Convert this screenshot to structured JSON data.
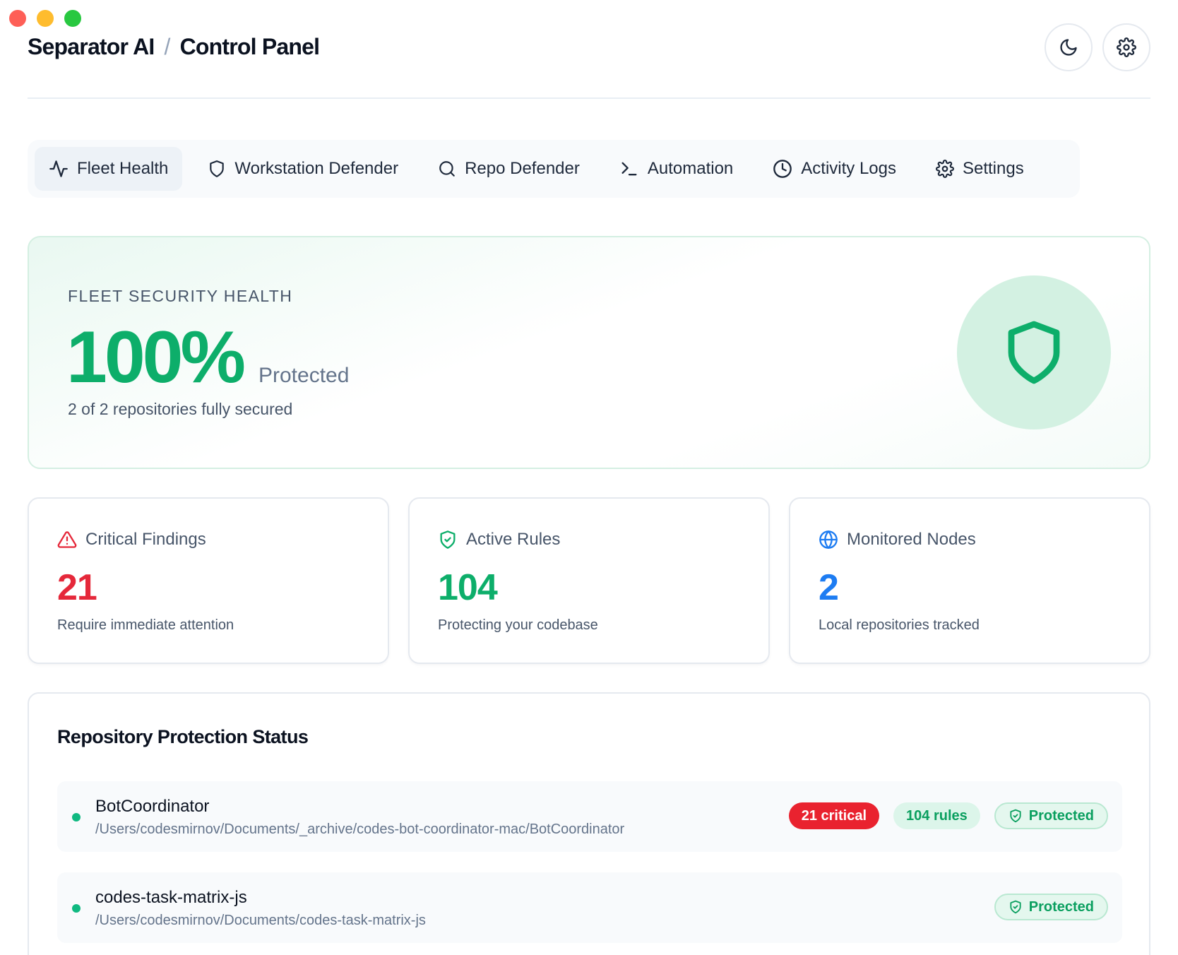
{
  "window": {
    "title": "Separator AI",
    "section": "Control Panel",
    "separator": "/"
  },
  "header": {
    "buttons": [
      {
        "icon": "moon-icon"
      },
      {
        "icon": "gear-icon"
      }
    ]
  },
  "tabs": [
    {
      "label": "Fleet Health",
      "icon": "activity-icon",
      "active": true
    },
    {
      "label": "Workstation Defender",
      "icon": "shield-icon",
      "active": false
    },
    {
      "label": "Repo Defender",
      "icon": "search-icon",
      "active": false
    },
    {
      "label": "Automation",
      "icon": "terminal-icon",
      "active": false
    },
    {
      "label": "Activity Logs",
      "icon": "clock-icon",
      "active": false
    },
    {
      "label": "Settings",
      "icon": "gear-icon",
      "active": false
    }
  ],
  "hero": {
    "label": "FLEET SECURITY HEALTH",
    "value": "100%",
    "status": "Protected",
    "subtitle": "2 of 2 repositories fully secured",
    "icon": "shield-icon"
  },
  "stats": [
    {
      "title": "Critical Findings",
      "value": "21",
      "desc": "Require immediate attention",
      "icon": "alert-triangle-icon",
      "color": "#e5283a"
    },
    {
      "title": "Active Rules",
      "value": "104",
      "desc": "Protecting your codebase",
      "icon": "shield-check-icon",
      "color": "#0dae6a"
    },
    {
      "title": "Monitored Nodes",
      "value": "2",
      "desc": "Local repositories tracked",
      "icon": "globe-icon",
      "color": "#1d7cf2"
    }
  ],
  "repos": {
    "title": "Repository Protection Status",
    "items": [
      {
        "name": "BotCoordinator",
        "path": "/Users/codesmirnov/Documents/_archive/codes-bot-coordinator-mac/BotCoordinator",
        "critical": "21 critical",
        "rules": "104 rules",
        "status": "Protected"
      },
      {
        "name": "codes-task-matrix-js",
        "path": "/Users/codesmirnov/Documents/codes-task-matrix-js",
        "status": "Protected"
      }
    ]
  },
  "colors": {
    "accent_green": "#0dae6a",
    "critical_red": "#e5283a",
    "info_blue": "#1d7cf2",
    "status_dot": "#10b981"
  }
}
